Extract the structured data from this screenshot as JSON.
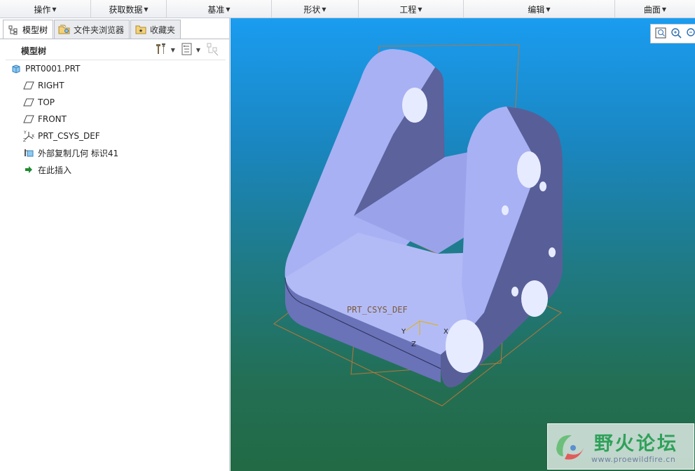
{
  "ribbon": {
    "groups": [
      {
        "label": "操作"
      },
      {
        "label": "获取数据"
      },
      {
        "label": "基准"
      },
      {
        "label": "形状"
      },
      {
        "label": "工程"
      },
      {
        "label": "编辑"
      },
      {
        "label": "曲面"
      }
    ]
  },
  "left_panel": {
    "tabs": [
      {
        "label": "模型树",
        "icon": "model-tree-icon",
        "active": true
      },
      {
        "label": "文件夹浏览器",
        "icon": "folder-browser-icon",
        "active": false
      },
      {
        "label": "收藏夹",
        "icon": "favorites-icon",
        "active": false
      }
    ],
    "tree_title": "模型树",
    "tree_items": [
      {
        "label": "PRT0001.PRT",
        "icon": "part-icon",
        "level": 0
      },
      {
        "label": "RIGHT",
        "icon": "datum-plane-icon",
        "level": 1
      },
      {
        "label": "TOP",
        "icon": "datum-plane-icon",
        "level": 1
      },
      {
        "label": "FRONT",
        "icon": "datum-plane-icon",
        "level": 1
      },
      {
        "label": "PRT_CSYS_DEF",
        "icon": "coordinate-system-icon",
        "level": 1
      },
      {
        "label": "外部复制几何 标识41",
        "icon": "external-copy-geometry-icon",
        "level": 1
      },
      {
        "label": "在此插入",
        "icon": "insert-here-arrow-icon",
        "level": 1
      }
    ]
  },
  "viewport": {
    "csys_label": "PRT_CSYS_DEF",
    "axis_labels": {
      "x": "X",
      "y": "Y",
      "z": "Z"
    },
    "colors": {
      "model_face": "#a6b0f2",
      "model_side": "#585f98",
      "datum_plane": "#b8763a",
      "csys": "#e0b100"
    }
  },
  "watermark": {
    "title": "野火论坛",
    "url": "www.proewildfire.cn"
  }
}
